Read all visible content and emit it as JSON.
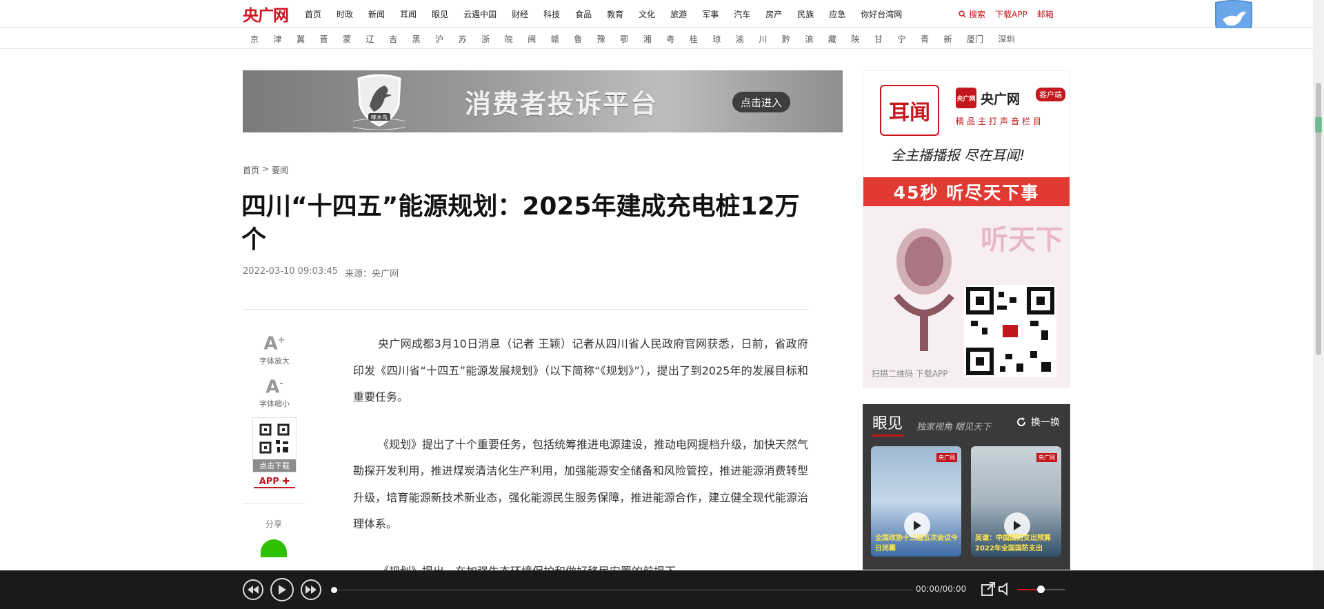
{
  "header": {
    "logo_text": "央广网",
    "nav": [
      "首页",
      "时政",
      "新闻",
      "耳闻",
      "眼见",
      "云遇中国",
      "财经",
      "科技",
      "食品",
      "教育",
      "文化",
      "旅游",
      "军事",
      "汽车",
      "房产",
      "民族",
      "应急",
      "你好台湾网"
    ],
    "search_label": "搜索",
    "download_label": "下载APP",
    "mail_label": "邮箱"
  },
  "provinces": [
    "京",
    "津",
    "冀",
    "晋",
    "蒙",
    "辽",
    "吉",
    "黑",
    "沪",
    "苏",
    "浙",
    "皖",
    "闽",
    "赣",
    "鲁",
    "豫",
    "鄂",
    "湘",
    "粤",
    "桂",
    "琼",
    "渝",
    "川",
    "黔",
    "滇",
    "藏",
    "陕",
    "甘",
    "宁",
    "青",
    "新",
    "厦门",
    "深圳"
  ],
  "banner": {
    "title": "消费者投诉平台",
    "enter_label": "点击进入",
    "badge_text": "啄木鸟"
  },
  "breadcrumb": {
    "home": "首页",
    "sep": ">",
    "current": "要闻"
  },
  "article": {
    "title": "四川“十四五”能源规划：2025年建成充电桩12万个",
    "datetime": "2022-03-10 09:03:45",
    "source_label": "来源：",
    "source": "央广网",
    "paragraphs": [
      "央广网成都3月10日消息（记者 王颖）记者从四川省人民政府官网获悉，日前，省政府印发《四川省“十四五”能源发展规划》（以下简称“《规划》”），提出了到2025年的发展目标和重要任务。",
      "《规划》提出了十个重要任务，包括统筹推进电源建设，推动电网提档升级，加快天然气勘探开发利用，推进煤炭清洁化生产利用，加强能源安全储备和风险管控，推进能源消费转型升级，培育能源新技术新业态，强化能源民生服务保障，推进能源合作，建立健全现代能源治理体系。",
      "《规划》提出，在加强生态环境保护和做好移民安置的前提下，"
    ]
  },
  "tools": {
    "font_up_glyph": "A",
    "font_up_sup": "+",
    "font_up": "字体放大",
    "font_down_glyph": "A",
    "font_down_sup": "-",
    "font_down": "字体缩小",
    "qr_download": "点击下载",
    "app_label": "APP",
    "share_label": "分享"
  },
  "ad": {
    "erwen": "耳闻",
    "brand": "央广网",
    "brand_mini": "央广网",
    "client": "客户端",
    "sub": "精品主打声音栏目",
    "slogan": "全主播播报 尽在耳闻!",
    "band": "45秒 听尽天下事",
    "listen": "听天下",
    "scan": "扫描二维码 下载APP"
  },
  "yanjian": {
    "title": "眼见",
    "subtitle": "独家视角 眼见天下",
    "refresh": "换一换",
    "cards": [
      {
        "tag": "央广网",
        "caption": "全国政协十三届五次会议今日闭幕"
      },
      {
        "tag": "央广网",
        "caption": "吴谦：中国国防支出预算 2022年全国国防支出"
      }
    ]
  },
  "player": {
    "time": "00:00/00:00"
  },
  "colors": {
    "brand_red": "#c4171d",
    "player_bg": "#1a1a1a"
  }
}
